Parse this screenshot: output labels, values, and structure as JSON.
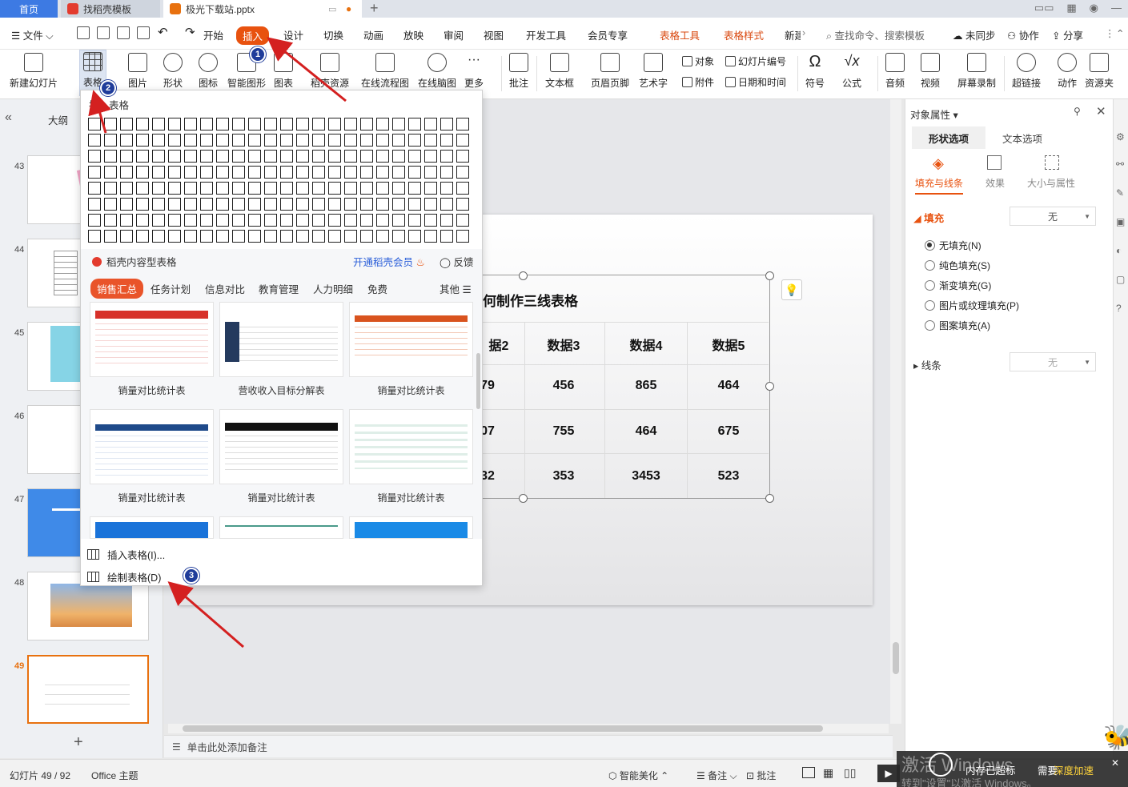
{
  "titlebar": {
    "tab_home": "首页",
    "tab_template": "找稻壳模板",
    "tab_file": "极光下载站.pptx"
  },
  "menubar": {
    "file": "文件",
    "items": [
      "开始",
      "插入",
      "设计",
      "切换",
      "动画",
      "放映",
      "审阅",
      "视图",
      "开发工具",
      "会员专享",
      "表格工具",
      "表格样式",
      "新建"
    ],
    "search": "查找命令、搜索模板",
    "sync": "未同步",
    "collab": "协作",
    "share": "分享"
  },
  "ribbon": {
    "new_slide": "新建幻灯片",
    "table": "表格",
    "picture": "图片",
    "shape": "形状",
    "icon": "图标",
    "smart_graphic": "智能图形",
    "chart": "图表",
    "docer_resource": "稻壳资源",
    "online_flowchart": "在线流程图",
    "online_mindmap": "在线脑图",
    "more": "更多",
    "comment": "批注",
    "textbox": "文本框",
    "header_footer": "页眉页脚",
    "wordart": "艺术字",
    "object": "对象",
    "slide_number": "幻灯片编号",
    "attachment": "附件",
    "datetime": "日期和时间",
    "symbol": "符号",
    "formula": "公式",
    "audio": "音频",
    "video": "视频",
    "screen_record": "屏幕录制",
    "hyperlink": "超链接",
    "action": "动作",
    "resource_folder": "资源夹"
  },
  "dropdown": {
    "insert_table_header": "插入表格",
    "docer_tables": "稻壳内容型表格",
    "open_member": "开通稻壳会员",
    "feedback": "反馈",
    "tabs": [
      "销售汇总",
      "任务计划",
      "信息对比",
      "教育管理",
      "人力明细",
      "免费"
    ],
    "other": "其他",
    "cards": [
      "销量对比统计表",
      "营收收入目标分解表",
      "销量对比统计表",
      "销量对比统计表",
      "销量对比统计表",
      "销量对比统计表"
    ],
    "insert_table": "插入表格(I)...",
    "draw_table": "绘制表格(D)"
  },
  "leftpanel": {
    "outline": "大纲",
    "slide_numbers": [
      "43",
      "44",
      "45",
      "46",
      "47",
      "48",
      "49"
    ]
  },
  "slide": {
    "title": "何制作三线表格",
    "headers": [
      "据2",
      "数据3",
      "数据4",
      "数据5"
    ],
    "rows": [
      [
        "79",
        "456",
        "865",
        "464"
      ],
      [
        "07",
        "755",
        "464",
        "675"
      ],
      [
        "32",
        "353",
        "3453",
        "523"
      ]
    ]
  },
  "notes_placeholder": "单击此处添加备注",
  "rightpanel": {
    "title": "对象属性",
    "tab_shape": "形状选项",
    "tab_text": "文本选项",
    "sub_fill_line": "填充与线条",
    "sub_effect": "效果",
    "sub_size": "大小与属性",
    "fill_label": "填充",
    "fill_value": "无",
    "options": [
      "无填充(N)",
      "纯色填充(S)",
      "渐变填充(G)",
      "图片或纹理填充(P)",
      "图案填充(A)"
    ],
    "line_label": "线条",
    "line_value": "无"
  },
  "statusbar": {
    "slide_info": "幻灯片 49 / 92",
    "theme": "Office 主题",
    "smart_beautify": "智能美化",
    "notes": "备注",
    "comments": "批注"
  },
  "overlay": {
    "memory_notice": "内存已超标",
    "need": "需要",
    "deep_speed": "深度加速",
    "activate": "激活 Windows",
    "activate_hint": "转到\"设置\"以激活 Windows。"
  },
  "badges": [
    "1",
    "2",
    "3"
  ],
  "colors": {
    "accent_orange": "#e8520f",
    "home_tab_blue": "#3d7ae3",
    "badge_blue": "#1f3c9a",
    "arrow_red": "#d42020"
  }
}
